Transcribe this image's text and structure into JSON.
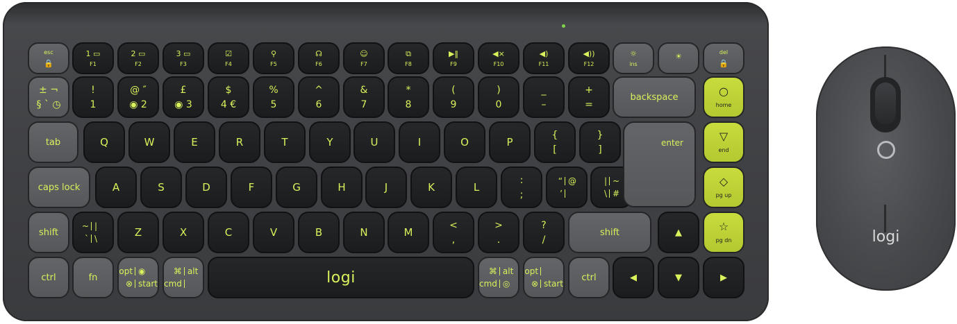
{
  "brand": "logi",
  "mouse_brand": "logi",
  "row_fn": [
    {
      "icon": "",
      "text": "esc",
      "sub": "🔒",
      "style": "gray"
    },
    {
      "icon": "1 ▭",
      "text": "F1",
      "style": "black"
    },
    {
      "icon": "2 ▭",
      "text": "F2",
      "style": "black"
    },
    {
      "icon": "3 ▭",
      "text": "F3",
      "style": "black"
    },
    {
      "icon": "☑",
      "text": "F4",
      "style": "black"
    },
    {
      "icon": "⚲",
      "text": "F5",
      "style": "black"
    },
    {
      "icon": "☊",
      "text": "F6",
      "style": "black"
    },
    {
      "icon": "☺",
      "text": "F7",
      "style": "black"
    },
    {
      "icon": "⧉",
      "text": "F8",
      "style": "black"
    },
    {
      "icon": "▶‖",
      "text": "F9",
      "style": "black"
    },
    {
      "icon": "◀×",
      "text": "F10",
      "style": "black"
    },
    {
      "icon": "◀)",
      "text": "F11",
      "style": "black"
    },
    {
      "icon": "◀))",
      "text": "F12",
      "style": "black"
    },
    {
      "icon": "☼",
      "text": "ins",
      "style": "gray"
    },
    {
      "icon": "☀",
      "text": "",
      "style": "gray"
    },
    {
      "icon": "",
      "text": "del",
      "sub": "🔒",
      "style": "gray"
    }
  ],
  "row_num": [
    {
      "top": "± ¬",
      "bot": "§ ` ◷",
      "style": "gray"
    },
    {
      "top": "!",
      "bot": "1"
    },
    {
      "top": "@ ″",
      "bot": "◉ 2"
    },
    {
      "top": "£",
      "bot": "◉ 3"
    },
    {
      "top": "$",
      "bot": "4 €"
    },
    {
      "top": "%",
      "bot": "5"
    },
    {
      "top": "^",
      "bot": "6"
    },
    {
      "top": "&",
      "bot": "7"
    },
    {
      "top": "*",
      "bot": "8"
    },
    {
      "top": "(",
      "bot": "9"
    },
    {
      "top": ")",
      "bot": "0"
    },
    {
      "top": "_",
      "bot": "–"
    },
    {
      "top": "+",
      "bot": "="
    }
  ],
  "backspace": "backspace",
  "home": {
    "glyph": "○",
    "text": "home"
  },
  "tab": "tab",
  "row_q": [
    "Q",
    "W",
    "E",
    "R",
    "T",
    "Y",
    "U",
    "I",
    "O",
    "P"
  ],
  "brackets": [
    {
      "top": "{",
      "bot": "["
    },
    {
      "top": "}",
      "bot": "]"
    }
  ],
  "enter": "enter",
  "end": {
    "glyph": "▽",
    "text": "end"
  },
  "caps": "caps lock",
  "row_a": [
    "A",
    "S",
    "D",
    "F",
    "G",
    "H",
    "J",
    "K",
    "L"
  ],
  "semi": {
    "top": ":",
    "bot": ";"
  },
  "quote": {
    "quad": [
      "“",
      "@",
      "’",
      ""
    ]
  },
  "pipe": {
    "quad": [
      "|",
      "~",
      "\\",
      "#"
    ]
  },
  "pgup": {
    "glyph": "◇",
    "text": "pg up"
  },
  "shift_l": "shift",
  "tilde": {
    "quad": [
      "~",
      "|",
      "`",
      "\\"
    ]
  },
  "row_z": [
    "Z",
    "X",
    "C",
    "V",
    "B",
    "N",
    "M"
  ],
  "lt": {
    "top": "<",
    "bot": ","
  },
  "gt": {
    "top": ">",
    "bot": "."
  },
  "slash": {
    "top": "?",
    "bot": "/"
  },
  "shift_r": "shift",
  "up": "▲",
  "pgdn": {
    "glyph": "☆",
    "text": "pg dn"
  },
  "ctrl_l": "ctrl",
  "fn_key": "fn",
  "opt_l": {
    "quad": [
      "opt",
      "◉",
      "⊗",
      "start"
    ]
  },
  "cmd_l": {
    "quad": [
      "⌘",
      "alt",
      "cmd",
      ""
    ]
  },
  "cmd_r": {
    "quad": [
      "⌘",
      "alt",
      "cmd",
      "◎"
    ]
  },
  "opt_r": {
    "quad": [
      "opt",
      "",
      "⊗",
      "start"
    ]
  },
  "ctrl_r": "ctrl",
  "left": "◀",
  "down": "▼",
  "right": "▶"
}
